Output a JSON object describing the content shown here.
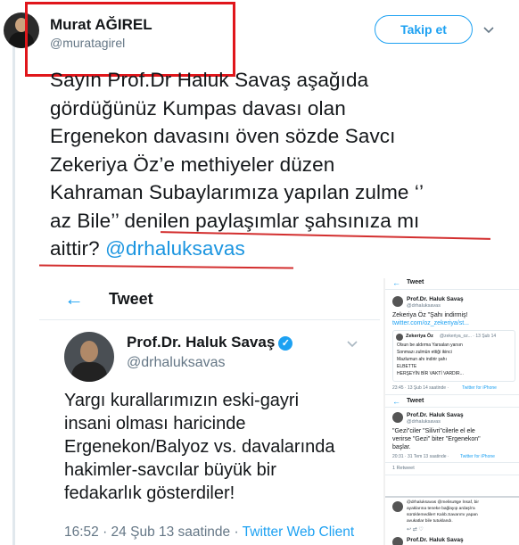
{
  "tweet": {
    "display_name": "Murat AĞIREL",
    "handle": "@muratagirel",
    "follow_label": "Takip et",
    "text_lines": [
      "Sayın Prof.Dr Haluk Savaş aşağıda",
      "gördüğünüz Kumpas davası olan",
      "Ergenekon davasını öven sözde Savcı",
      "Zekeriya Öz’e methiyeler düzen",
      "Kahraman Subaylarımıza yapılan zulme ‘’",
      "az Bile’’ denilen paylaşımlar şahsınıza mı",
      "aittir?"
    ],
    "mention": "@drhaluksavas",
    "colors": {
      "accent": "#1da1f2",
      "annotation_red": "#e0161b",
      "text": "#14171a",
      "muted": "#657786"
    }
  },
  "embedded_left": {
    "header_title": "Tweet",
    "back_icon": "arrow-left-icon",
    "name": "Prof.Dr. Haluk Savaş",
    "handle": "@drhaluksavas",
    "body_lines": [
      "Yargı kurallarımızın eski-gayri",
      "insani olması haricinde",
      "Ergenekon/Balyoz vs. davalarında",
      "hakimler-savcılar büyük bir",
      "fedakarlık gösterdiler!"
    ],
    "time": "16:52 · 24 Şub 13 saatinde ·",
    "client": "Twitter Web Client"
  },
  "embedded_right": {
    "header_title": "Tweet",
    "t1_name": "Prof.Dr. Haluk Savaş",
    "t1_handle": "@drhaluksavas",
    "t1_text": "Zekeriya Öz \"Şahı indirmiş!",
    "t1_link": "twitter.com/oz_zekeriya/st...",
    "q_name": "Zekeriya Öz",
    "q_handle": "@zekeriya_oz... · 13 Şub 14",
    "q_lines": [
      "Olsun be aldırma Yarsalan yarsın",
      "Sonmazı zulmün ettiği ikinci",
      "Mazlumun ahı indirir şahı",
      "ELBETTE",
      "HERŞEYİN BİR VAKTİ VARDIR..."
    ],
    "t1_meta": "23:45 · 13 Şub 14 saatinde ·",
    "t1_client": "Twitter for iPhone",
    "t2_name": "Prof.Dr. Haluk Savaş",
    "t2_handle": "@drhaluksavas",
    "t2_lines": [
      "\"Gezi\"ciler \"Silivri\"cilerle el ele",
      "verirse \"Gezi\" biter \"Ergenekon\"",
      "başlar."
    ],
    "t2_meta": "20:31 · 31 Tem 13 saatinde ·",
    "t2_client": "Twitter for iPhone",
    "t2_retweets": "1 Retweet",
    "t3_lines": [
      "@drhaluksavas @melisu9ge İnsaf, bir",
      "ayaklarına teneke bağlayıp ardaşlı'a",
      "sürüklemediler! Kalıb.Savarımı yapan",
      "avukatlar bile tutuklandı."
    ],
    "t4_name": "Prof.Dr. Haluk Savaş"
  }
}
